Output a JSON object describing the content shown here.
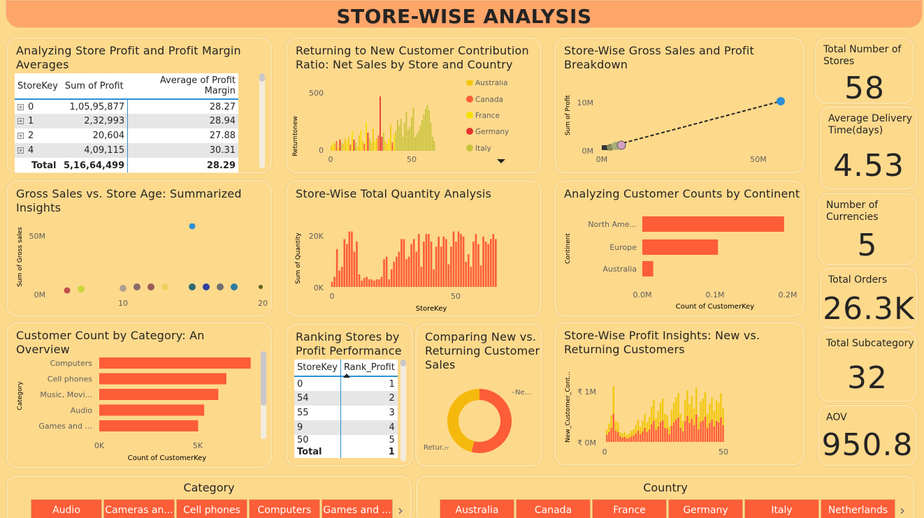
{
  "header": {
    "title": "STORE-WISE ANALYSIS"
  },
  "colors": {
    "accent": "#fd5d37",
    "background": "#fdd98c",
    "header": "#fea56a",
    "yellow": "#f2c811",
    "blue": "#2d8fd5"
  },
  "profit_table": {
    "title": "Analyzing Store Profit and Profit Margin Averages",
    "columns": [
      "StoreKey",
      "Sum of Profit",
      "Average of Profit Margin"
    ],
    "rows": [
      {
        "key": "0",
        "profit": "1,05,95,877",
        "margin": "28.27"
      },
      {
        "key": "1",
        "profit": "2,32,993",
        "margin": "28.94"
      },
      {
        "key": "2",
        "profit": "20,604",
        "margin": "27.88"
      },
      {
        "key": "4",
        "profit": "4,09,115",
        "margin": "30.31"
      }
    ],
    "total": {
      "label": "Total",
      "profit": "5,16,64,499",
      "margin": "28.29"
    }
  },
  "returning_ratio": {
    "title": "Returning to New Customer Contribution Ratio: Net Sales by Store and Country",
    "ylabel": "Returntonew",
    "yticks": [
      "500",
      "0"
    ],
    "xticks": [
      "0",
      "50"
    ],
    "legend": [
      {
        "name": "Australia",
        "color": "#f2c811"
      },
      {
        "name": "Canada",
        "color": "#fd5d37"
      },
      {
        "name": "France",
        "color": "#f7e000"
      },
      {
        "name": "Germany",
        "color": "#e8332c"
      },
      {
        "name": "Italy",
        "color": "#c7c33a"
      }
    ]
  },
  "gross_profit": {
    "title": "Store-Wise Gross Sales and Profit Breakdown",
    "ylabel": "Sum of Profit",
    "yticks": [
      "10M",
      "0M"
    ],
    "xticks": [
      "0M",
      "50M"
    ]
  },
  "kpis": {
    "total_stores": {
      "label": "Total Number of Stores",
      "value": "58"
    },
    "avg_delivery": {
      "label": "Average Delivery Time(days)",
      "value": "4.53"
    },
    "currencies": {
      "label": "Number of Currencies",
      "value": "5"
    },
    "total_orders": {
      "label": "Total Orders",
      "value": "26.3K"
    },
    "subcategory": {
      "label": "Total Subcategory",
      "value": "32"
    },
    "aov": {
      "label": "AOV",
      "value": "950.8"
    }
  },
  "gross_age": {
    "title": "Gross Sales vs. Store Age: Summarized Insights",
    "ylabel": "Sum of Gross sales",
    "yticks": [
      "50M",
      "0M"
    ],
    "xticks": [
      "10",
      "20"
    ]
  },
  "quantity": {
    "title": "Store-Wise Total Quantity Analysis",
    "ylabel": "Sum of Quantity",
    "xlabel": "StoreKey",
    "yticks": [
      "20K",
      "0K"
    ],
    "xticks": [
      "0",
      "50"
    ]
  },
  "continent": {
    "title": "Analyzing Customer Counts by Continent",
    "ylabel": "Continent",
    "xlabel": "Count of CustomerKey",
    "xticks": [
      "0.0M",
      "0.1M",
      "0.2M"
    ]
  },
  "category_count": {
    "title": "Customer Count by Category: An Overview",
    "ylabel": "Category",
    "xlabel": "Count of CustomerKey",
    "xticks": [
      "0K",
      "5K"
    ]
  },
  "ranking": {
    "title": "Ranking Stores by Profit Performance",
    "columns": [
      "StoreKey",
      "Rank_Profit"
    ],
    "rows": [
      {
        "key": "0",
        "rank": "1"
      },
      {
        "key": "54",
        "rank": "2"
      },
      {
        "key": "55",
        "rank": "3"
      },
      {
        "key": "9",
        "rank": "4"
      },
      {
        "key": "50",
        "rank": "5"
      }
    ],
    "total": {
      "label": "Total",
      "rank": "1"
    }
  },
  "donut": {
    "title": "Comparing New vs. Returning Customer Sales",
    "label_new": "Ne...",
    "label_ret": "Retur..."
  },
  "profit_insights": {
    "title": "Store-Wise Profit Insights: New vs. Returning Customers",
    "ylabel": "New_Customer_Cont...",
    "yticks": [
      "₹ 1M",
      "₹ 0M"
    ],
    "xticks": [
      "0",
      "50"
    ]
  },
  "slicers": {
    "category": {
      "title": "Category",
      "items": [
        "Audio",
        "Cameras an...",
        "Cell phones",
        "Computers",
        "Games and ..."
      ]
    },
    "country": {
      "title": "Country",
      "items": [
        "Australia",
        "Canada",
        "France",
        "Germany",
        "Italy",
        "Netherlands"
      ]
    }
  },
  "chart_data": [
    {
      "type": "bar",
      "title": "Analyzing Customer Counts by Continent",
      "categories": [
        "North Ame...",
        "Europe",
        "Australia"
      ],
      "values": [
        0.195,
        0.104,
        0.015
      ],
      "xlabel": "Count of CustomerKey",
      "ylabel": "Continent",
      "xlim": [
        0,
        0.2
      ]
    },
    {
      "type": "bar",
      "title": "Customer Count by Category: An Overview",
      "categories": [
        "Computers",
        "Cell phones",
        "Music, Movi...",
        "Audio",
        "Games and ..."
      ],
      "values": [
        7500,
        6300,
        5900,
        5200,
        4900
      ],
      "xlabel": "Count of CustomerKey",
      "ylabel": "Category",
      "xlim": [
        0,
        8000
      ]
    },
    {
      "type": "bar",
      "title": "Store-Wise Total Quantity Analysis",
      "x": [
        0,
        1,
        2,
        3,
        4,
        5,
        6,
        7,
        8,
        9,
        10,
        11,
        12,
        13,
        14,
        15,
        16,
        17,
        18,
        19,
        20,
        21,
        22,
        23,
        24,
        25,
        26,
        27,
        28,
        29,
        30,
        31,
        32,
        33,
        34,
        35,
        36,
        37,
        38,
        39,
        40,
        41,
        42,
        43,
        44,
        45,
        46,
        47,
        48,
        49,
        50,
        51,
        52,
        53,
        54,
        55,
        56,
        57,
        58,
        59,
        60,
        61,
        62,
        63,
        64,
        65,
        66
      ],
      "values": [
        2000,
        4000,
        15000,
        6500,
        8000,
        19000,
        17000,
        22000,
        22000,
        14000,
        18000,
        5000,
        2500,
        3500,
        4000,
        3000,
        3000,
        2500,
        3000,
        3000,
        4000,
        11000,
        12000,
        3000,
        7000,
        10000,
        12000,
        14000,
        19000,
        19000,
        11000,
        12000,
        17000,
        19000,
        14000,
        21000,
        8000,
        18000,
        21000,
        21000,
        18000,
        7000,
        16000,
        20000,
        16000,
        20000,
        19000,
        9000,
        16000,
        22000,
        18000,
        22000,
        21000,
        20000,
        10000,
        13000,
        8000,
        18000,
        21000,
        17000,
        8500,
        20000,
        18000,
        17000,
        19000,
        21000,
        19000
      ],
      "xlabel": "StoreKey",
      "ylabel": "Sum of Quantity",
      "ylim": [
        0,
        28000
      ]
    },
    {
      "type": "donut",
      "title": "Comparing New vs. Returning Customer Sales",
      "categories": [
        "Ne...",
        "Retur..."
      ],
      "values": [
        0.54,
        0.46
      ]
    }
  ]
}
